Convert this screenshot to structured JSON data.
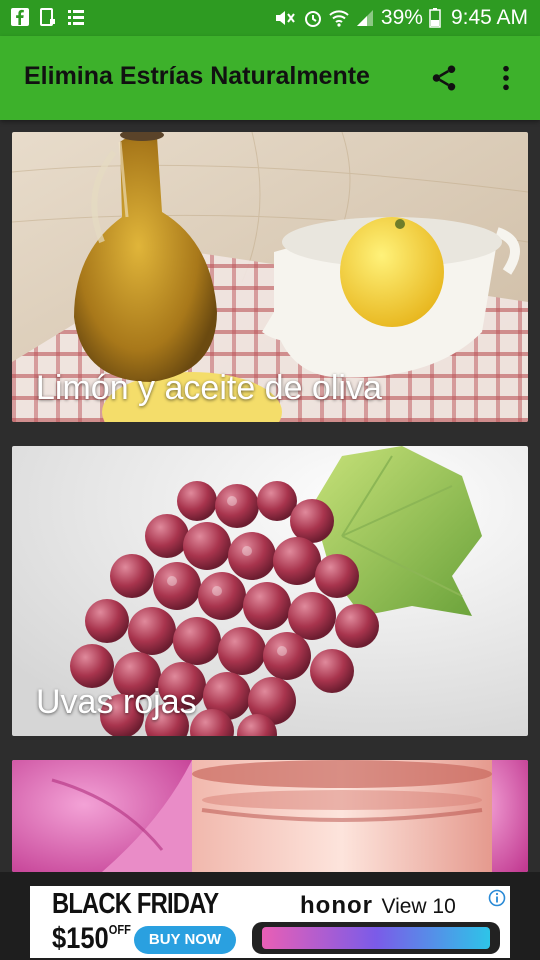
{
  "status": {
    "battery": "39%",
    "time": "9:45 AM",
    "left_icons": [
      "facebook-icon",
      "clipboard-icon",
      "list-icon"
    ],
    "right_icons": [
      "mute-icon",
      "alarm-icon",
      "wifi-icon",
      "signal-icon",
      "battery-icon"
    ]
  },
  "appbar": {
    "title": "Elimina Estrías Naturalmente",
    "share_icon": "share-icon",
    "menu_icon": "more-vert-icon"
  },
  "cards": [
    {
      "label": "Limón y aceite de oliva"
    },
    {
      "label": "Uvas rojas"
    },
    {
      "label": ""
    }
  ],
  "ad": {
    "headline": "BLACK FRIDAY",
    "price": "$150",
    "price_suffix": "OFF",
    "cta": "BUY NOW",
    "brand": "honor",
    "model": "View 10",
    "info_icon": "info-icon"
  },
  "colors": {
    "status_bar": "#2e9b22",
    "app_bar": "#3db12b",
    "background": "#2d2d2d",
    "ad_cta": "#2aa0e0"
  }
}
